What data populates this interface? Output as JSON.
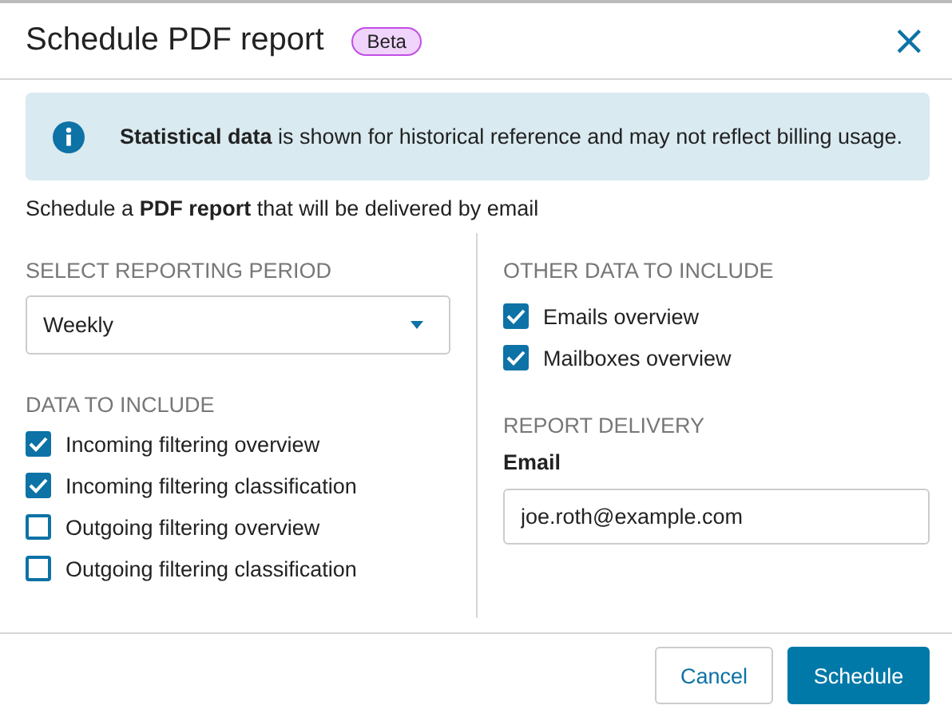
{
  "dialog": {
    "title": "Schedule PDF report",
    "badge": "Beta",
    "close": "×"
  },
  "info": {
    "text": "**Statistical data**  is shown for historical reference and may not reflect billing usage."
  },
  "subtitle": "Schedule a **PDF report** that will be delivered by email",
  "period": {
    "heading": "SELECT REPORTING PERIOD",
    "value": "Weekly"
  },
  "data_to_include": {
    "heading": "DATA TO INCLUDE",
    "items": [
      {
        "label": "Incoming filtering overview",
        "checked": true
      },
      {
        "label": "Incoming filtering classification",
        "checked": true
      },
      {
        "label": "Outgoing filtering overview",
        "checked": false
      },
      {
        "label": "Outgoing filtering classification",
        "checked": false
      }
    ]
  },
  "other_data": {
    "heading": "OTHER DATA TO INCLUDE",
    "items": [
      {
        "label": "Emails overview",
        "checked": true
      },
      {
        "label": "Mailboxes overview",
        "checked": true
      }
    ]
  },
  "delivery": {
    "heading": "REPORT DELIVERY",
    "label": "Email",
    "value": "joe.roth@example.com"
  },
  "buttons": [
    {
      "label": "Cancel",
      "kind": "secondary"
    },
    {
      "label": "Schedule",
      "kind": "primary"
    }
  ]
}
